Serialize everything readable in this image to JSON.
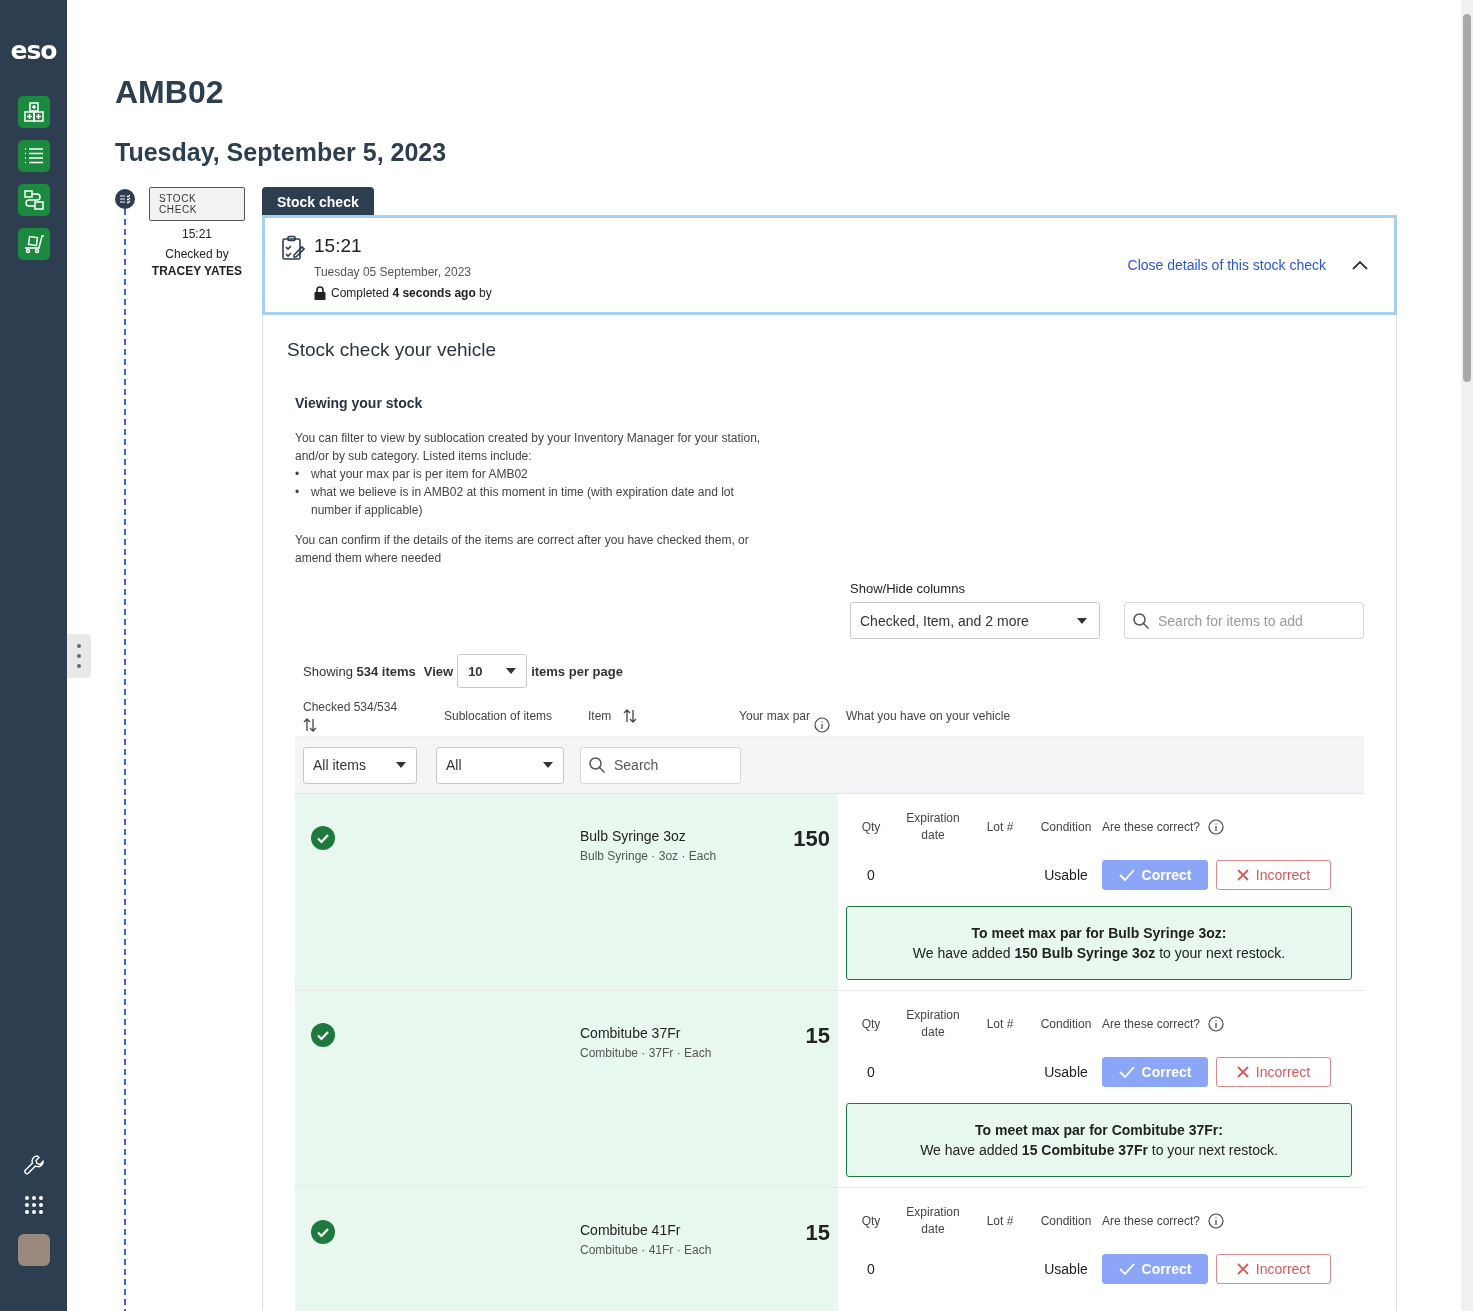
{
  "sidebar": {
    "logo": "eso"
  },
  "page": {
    "title": "AMB02",
    "date": "Tuesday, September 5, 2023"
  },
  "timeline": {
    "badge": "STOCK CHECK",
    "time": "15:21",
    "checked_by_label": "Checked by",
    "checked_by": "TRACEY YATES"
  },
  "tab": "Stock check",
  "summary": {
    "time": "15:21",
    "date": "Tuesday 05 September, 2023",
    "status": "Completed **4 seconds ago** by",
    "close_link": "Close details of this stock check",
    "expanded": true
  },
  "section": {
    "title": "Stock check your vehicle",
    "subtitle": "Viewing your stock",
    "intro": "You can filter to view by sublocation created by your Inventory Manager for your station, and/or by sub category. Listed items include:",
    "bullets": [
      {
        "marker": "•",
        "text": "what your max par is per item for AMB02"
      },
      {
        "marker": "•",
        "text": "what we believe is in AMB02 at this moment in time (with expiration date and lot number if applicable)"
      }
    ],
    "outro": "You can confirm if the details of the items are correct after you have checked them, or amend them where needed"
  },
  "columns_control": {
    "label": "Show/Hide columns",
    "value": "Checked, Item, and 2 more"
  },
  "item_search": {
    "placeholder": "Search for items to add"
  },
  "paging": {
    "showing": "Showing **534 items**",
    "view_label": "View",
    "per_page": "10",
    "per_page_label": "items per page"
  },
  "table": {
    "columns": [
      "Checked 534/534",
      "Sublocation of items",
      "Item",
      "Your max par",
      "What you have on your vehicle"
    ],
    "filters": {
      "checked": "All items",
      "sublocation": "All",
      "search_placeholder": "Search"
    },
    "rows": [
      {
        "checked": true,
        "name": "Bulb Syringe 3oz",
        "detail": "Bulb Syringe · 3oz · Each",
        "max_par": "150",
        "labels": [
          "Qty",
          "Expiration date",
          "Lot #",
          "Condition",
          "Are these correct?"
        ],
        "qty": "0",
        "condition": "Usable",
        "buttons": [
          {
            "label": "Correct",
            "kind": "correct",
            "selected": true
          },
          {
            "label": "Incorrect",
            "kind": "incorrect",
            "selected": false
          }
        ],
        "notice": {
          "title": "To meet max par for Bulb Syringe 3oz:",
          "text": "We have added **150 Bulb Syringe 3oz** to your next restock."
        }
      },
      {
        "checked": true,
        "name": "Combitube 37Fr",
        "detail": "Combitube · 37Fr · Each",
        "max_par": "15",
        "labels": [
          "Qty",
          "Expiration date",
          "Lot #",
          "Condition",
          "Are these correct?"
        ],
        "qty": "0",
        "condition": "Usable",
        "buttons": [
          {
            "label": "Correct",
            "kind": "correct",
            "selected": true
          },
          {
            "label": "Incorrect",
            "kind": "incorrect",
            "selected": false
          }
        ],
        "notice": {
          "title": "To meet max par for Combitube 37Fr:",
          "text": "We have added **15 Combitube 37Fr** to your next restock."
        }
      },
      {
        "checked": true,
        "name": "Combitube 41Fr",
        "detail": "Combitube · 41Fr · Each",
        "max_par": "15",
        "labels": [
          "Qty",
          "Expiration date",
          "Lot #",
          "Condition",
          "Are these correct?"
        ],
        "qty": "0",
        "condition": "Usable",
        "buttons": [
          {
            "label": "Correct",
            "kind": "correct",
            "selected": true
          },
          {
            "label": "Incorrect",
            "kind": "incorrect",
            "selected": false
          }
        ]
      }
    ]
  }
}
